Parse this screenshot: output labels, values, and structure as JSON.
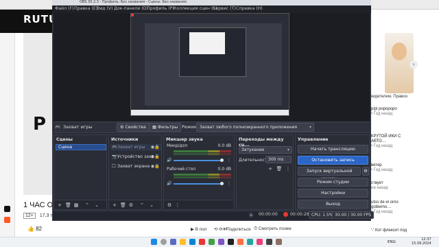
{
  "obs": {
    "window_title": "OBS 30.2.3 - Профиль: Без названия - Сцены: Без названия",
    "menu": [
      "Файл (F)",
      "Правка (E)",
      "Вид (V)",
      "Док-панели (D)",
      "Профиль (P)",
      "Коллекция сцен (S)",
      "Сервис (T)",
      "Справка (H)"
    ],
    "source_toolbar": {
      "source_name": "Захват игры",
      "properties": "Свойства",
      "filters": "Фильтры",
      "mode_label": "Режим",
      "mode_value": "Захват любого полноэкранного приложения"
    },
    "scenes": {
      "title": "Сцены",
      "items": [
        "Сцена"
      ]
    },
    "sources": {
      "title": "Источники",
      "items": [
        {
          "icon": "gamepad-icon",
          "label": "Захват игры"
        },
        {
          "icon": "camera-icon",
          "label": "Устройство захв"
        },
        {
          "icon": "monitor-icon",
          "label": "Захват экрана"
        }
      ]
    },
    "mixer": {
      "title": "Микшер звука",
      "channels": [
        {
          "label": "Микр/доп",
          "db": "0.0 dB"
        },
        {
          "label": "Рабочий стол",
          "db": "0.0 dB"
        }
      ]
    },
    "transitions": {
      "title": "Переходы между сц...",
      "type": "Затухание",
      "duration_label": "Длительность",
      "duration_value": "300 ms"
    },
    "controls": {
      "title": "Управление",
      "buttons": {
        "start_stream": "Начать трансляцию",
        "stop_recording": "Остановить запись",
        "virtual_cam": "Запуск виртуальной камеры",
        "studio_mode": "Режим студии",
        "settings": "Настройки",
        "exit": "Выход"
      }
    },
    "status": {
      "stream_time": "00:00:00",
      "rec_time": "00:00:28",
      "cpu": "CPU: 1.5%",
      "fps": "30.00 / 30.00 FPS"
    }
  },
  "page": {
    "logo": "RUTU",
    "video_big_text": "P",
    "video_title": "1 ЧАС О",
    "video_meta": "17,3 тыс.",
    "video_meta_badge": "12+",
    "likes": "82",
    "actions": {
      "later": "В пол",
      "share": "Поделиться",
      "watch_later": "Смотреть позже"
    },
    "recommendations": [
      {
        "title": "pipi роророро",
        "sub": "• Год назад"
      },
      {
        "title": "КРУТОЙ ИКИ С АВТО…",
        "sub": "• Год назад"
      },
      {
        "title": "ветер",
        "sub": "• Год назад"
      },
      {
        "title": "ствует",
        "sub": "на назад"
      },
      {
        "title": "utos de el orno gobierno…",
        "sub": "• Год назад"
      },
      {
        "title": "'-' Кот флексит под",
        "sub": ""
      }
    ],
    "right_top_label": "видетелем. Правоо"
  },
  "taskbar": {
    "lang": "ENG",
    "time": "12:37",
    "date": "15.09.2024"
  }
}
